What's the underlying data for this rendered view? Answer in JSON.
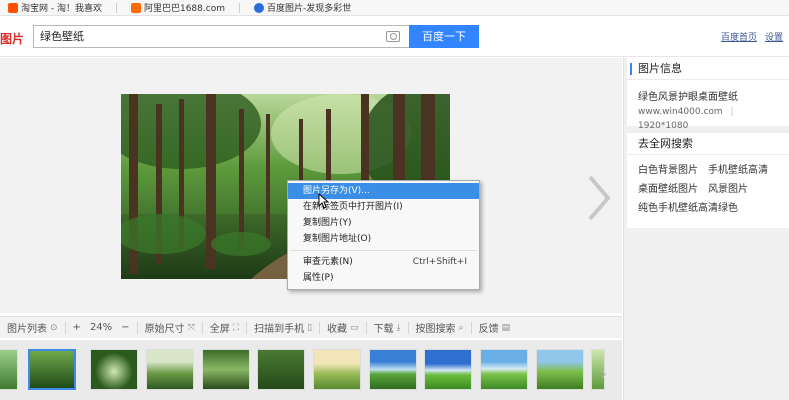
{
  "bookmarks": [
    {
      "label": "淘宝网 - 淘！我喜欢",
      "color": "#ff5000"
    },
    {
      "label": "阿里巴巴1688.com",
      "color": "#ff6a00"
    },
    {
      "label": "百度图片-发现多彩世",
      "color": "#2b6cde"
    }
  ],
  "header": {
    "logo": "图片",
    "search_value": "绿色壁纸",
    "search_button": "百度一下",
    "links": [
      "百度首页",
      "设置"
    ]
  },
  "context_menu": {
    "items": [
      {
        "label": "图片另存为(V)...",
        "shortcut": "",
        "active": true
      },
      {
        "label": "在新标签页中打开图片(I)",
        "shortcut": "",
        "active": false
      },
      {
        "label": "复制图片(Y)",
        "shortcut": "",
        "active": false
      },
      {
        "label": "复制图片地址(O)",
        "shortcut": "",
        "active": false
      },
      {
        "label": "审查元素(N)",
        "shortcut": "Ctrl+Shift+I",
        "active": false
      },
      {
        "label": "属性(P)",
        "shortcut": "",
        "active": false
      }
    ]
  },
  "toolbar": {
    "list": "图片列表",
    "zoom_in": "+",
    "zoom": "24%",
    "zoom_out": "−",
    "original": "原始尺寸",
    "fullscreen": "全屏",
    "scan": "扫描到手机",
    "favorite": "收藏",
    "download": "下载",
    "search_by_image": "按图搜索",
    "feedback": "反馈"
  },
  "sidebar": {
    "info_title": "图片信息",
    "image_title": "绿色风景护眼桌面壁纸",
    "source": "www.win4000.com",
    "size": "1920*1080",
    "search_title": "去全网搜索",
    "tags": [
      "白色背景图片",
      "手机壁纸高清",
      "桌面壁纸图片",
      "风景图片",
      "纯色手机壁纸高清绿色"
    ]
  },
  "colors": {
    "accent": "#3385ff",
    "menu_highlight": "#3a8ee6",
    "logo_red": "#d72c2c"
  }
}
